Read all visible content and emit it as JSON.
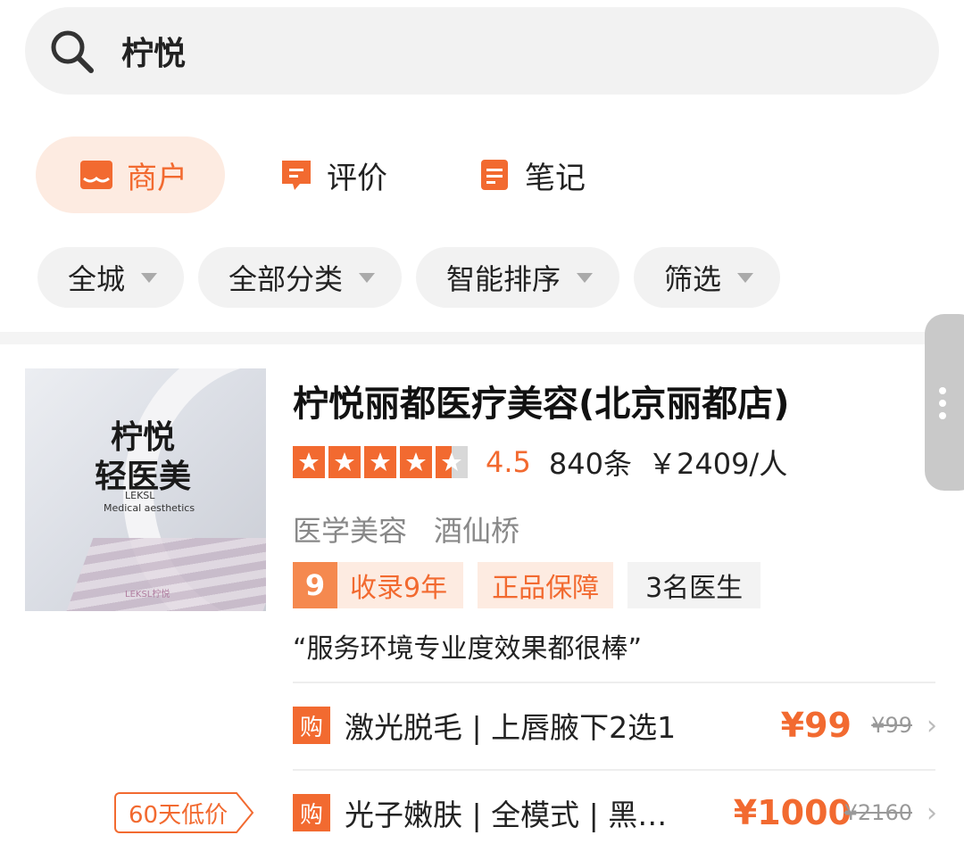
{
  "search": {
    "query": "柠悦"
  },
  "tabs": [
    {
      "label": "商户",
      "icon": "shop-icon",
      "active": true
    },
    {
      "label": "评价",
      "icon": "review-icon",
      "active": false
    },
    {
      "label": "笔记",
      "icon": "note-icon",
      "active": false
    }
  ],
  "filters": [
    {
      "label": "全城"
    },
    {
      "label": "全部分类"
    },
    {
      "label": "智能排序"
    },
    {
      "label": "筛选"
    }
  ],
  "shop": {
    "thumbnail": {
      "title_line1": "柠悦",
      "title_line2": "轻医美",
      "en_line1": "LEKSL",
      "en_line2": "Medical aesthetics",
      "footer": "LEKSL柠悦"
    },
    "name": "柠悦丽都医疗美容(北京丽都店)",
    "rating": 4.5,
    "score": "4.5",
    "reviews": "840条",
    "avg_price": "￥2409/人",
    "category": "医学美容",
    "area": "酒仙桥",
    "badge_years_icon": "9",
    "badge_years": "收录9年",
    "badge_genuine": "正品保障",
    "badge_doctors": "3名医生",
    "quote": "“服务环境专业度效果都很棒”"
  },
  "deals": [
    {
      "buy_icon": "购",
      "title": "激光脱毛 | 上唇腋下2选1",
      "price": "¥99",
      "original": "¥99"
    },
    {
      "buy_icon": "购",
      "title": "光子嫩肤 | 全模式 | 黑…",
      "price": "¥1000",
      "original": "¥2160"
    }
  ],
  "low_price_tag": "60天低价",
  "colors": {
    "accent": "#f26a30",
    "accent_light": "#fdebe1",
    "pill_bg": "#f2f2f2"
  }
}
